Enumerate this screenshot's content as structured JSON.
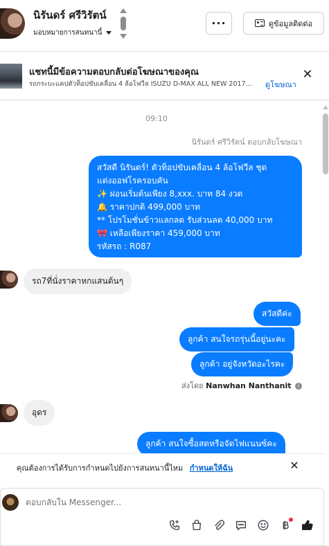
{
  "header": {
    "name": "นิรันดร์ ศรีวิรัตน์",
    "assign_label": "มอบหมายการสนทนานี้",
    "more_label": "···",
    "contact_label": "ดูข้อมูลติดต่อ"
  },
  "ad_banner": {
    "title": "แชทนี้มีข้อความตอบกลับต่อโฆษณาของคุณ",
    "description": "รถกระบะแคปตัวท็อปขับเคลื่อน 4 ล้อโฟวีล ISUZU D-MAX ALL NEW 2017...",
    "link_label": "ดูโฆษณา"
  },
  "chat": {
    "time": "09:10",
    "replied_note": "นิรันดร์ ศรีวิรัตน์ ตอบกลับโฆษณา",
    "ad_message_lines": [
      "สวัสดี นิรันดร์! ตัวท็อปขับเคลื่อน 4 ล้อโฟวีล ชุด",
      "แต่งออฟโรครอบคัน",
      "✨  ผ่อนเริ่มต้นเพียง 8,xxx. บาท 84 งวด",
      "🔔 ราคาปกติ 499,000 บาท",
      "** โปรโมชั่นข้าวแลกลด รับส่วนลด 40,000 บาท",
      "🎀  เหลือเพียงราคา 459,000 บาท",
      " รหัสรถ : R087"
    ],
    "in_message_1": "รถ7ที่นั่งราคาหกแสนต้นๆ",
    "out_message_1": "สวัสดีค่ะ",
    "out_message_2": "ลูกค้า สนใจรถรุ่นนี้อยู่นะคะ",
    "out_message_3": "ลูกค้า อยู่จังหวัดอะไรคะ",
    "sent_by_prefix": "ส่งโดย",
    "sent_by_name": "Nanwhan Nanthanit",
    "in_message_2": "อุดร",
    "out_message_4": "ลูกค้า สนใจซื้อสดหรือจัดไฟแนนซ์คะ"
  },
  "notice": {
    "text": "คุณต้องการได้รับการกำหนดไปยังการสนทนานี้ไหม",
    "link_label": "กำหนดให้ฉัน"
  },
  "composer": {
    "placeholder": "ตอบกลับใน Messenger..."
  },
  "colors": {
    "outgoing_bubble": "#0a7cff",
    "incoming_bubble": "#f0f0f0",
    "link": "#0064d1"
  }
}
